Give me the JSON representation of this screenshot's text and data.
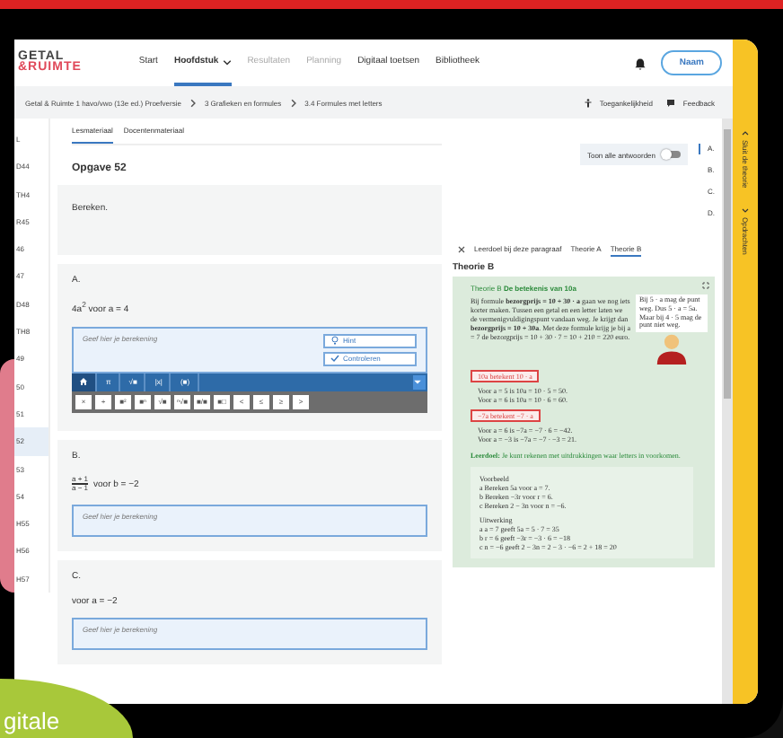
{
  "header": {
    "logo": {
      "line1": "GETAL",
      "line2": "&RUIMTE"
    },
    "nav": [
      {
        "label": "Start",
        "selected": false,
        "disabled": false,
        "dropdown": false
      },
      {
        "label": "Hoofdstuk",
        "selected": true,
        "disabled": false,
        "dropdown": true
      },
      {
        "label": "Resultaten",
        "selected": false,
        "disabled": true,
        "dropdown": false
      },
      {
        "label": "Planning",
        "selected": false,
        "disabled": true,
        "dropdown": false
      },
      {
        "label": "Digitaal toetsen",
        "selected": false,
        "disabled": false,
        "dropdown": false
      },
      {
        "label": "Bibliotheek",
        "selected": false,
        "disabled": false,
        "dropdown": false
      }
    ],
    "user_button": "Naam"
  },
  "breadcrumb": [
    "Getal & Ruimte 1 havo/vwo (13e ed.) Proefversie",
    "3 Grafieken en formules",
    "3.4 Formules met letters"
  ],
  "header_links": [
    {
      "kind": "accessibility",
      "label": "Toegankelijkheid"
    },
    {
      "kind": "feedback",
      "label": "Feedback"
    }
  ],
  "exercise_list": [
    {
      "label": "L",
      "selected": false
    },
    {
      "label": "D44",
      "selected": false
    },
    {
      "label": "TH4",
      "selected": false
    },
    {
      "label": "R45",
      "selected": false
    },
    {
      "label": "46",
      "selected": false
    },
    {
      "label": "47",
      "selected": false
    },
    {
      "label": "D48",
      "selected": false
    },
    {
      "label": "TH8",
      "selected": false
    },
    {
      "label": "49",
      "selected": false
    },
    {
      "label": "50",
      "selected": false
    },
    {
      "label": "51",
      "selected": false
    },
    {
      "label": "52",
      "selected": true
    },
    {
      "label": "53",
      "selected": false
    },
    {
      "label": "54",
      "selected": false
    },
    {
      "label": "H55",
      "selected": false
    },
    {
      "label": "H56",
      "selected": false
    },
    {
      "label": "H57",
      "selected": false
    }
  ],
  "content_tabs": [
    {
      "label": "Lesmateriaal",
      "selected": true
    },
    {
      "label": "Docentenmateriaal",
      "selected": false
    }
  ],
  "title": "Opgave 52",
  "intro": "Bereken.",
  "parts": [
    {
      "label": "A.",
      "formula": {
        "kind": "text",
        "text": "4a$^{2}$ voor a = 4"
      },
      "answer_placeholder": "Geef hier je berekening",
      "buttons": [
        {
          "kind": "hint",
          "label": "Hint"
        },
        {
          "kind": "check",
          "label": "Controleren"
        }
      ],
      "keyboard": {
        "tabs": [
          {
            "kind": "home",
            "selected": true
          },
          {
            "kind": "text",
            "label": "π",
            "selected": false
          },
          {
            "kind": "text",
            "label": "√■",
            "selected": false
          },
          {
            "kind": "text",
            "label": "|x|",
            "selected": false
          },
          {
            "kind": "text",
            "label": "(■)",
            "selected": false
          }
        ],
        "keys": [
          "×",
          "+",
          "■²",
          "■ⁿ",
          "√■",
          "ⁿ√■",
          "■/■",
          "■□",
          "<",
          "≤",
          "≥",
          ">"
        ]
      }
    },
    {
      "label": "B.",
      "formula": {
        "kind": "fraction",
        "numerator": "a + 1",
        "denominator": "a − 1",
        "text": "voor b = −2"
      },
      "answer_placeholder": "Geef hier je berekening"
    },
    {
      "label": "C.",
      "formula": {
        "kind": "text",
        "text": "voor a = −2"
      },
      "answer_placeholder": "Geef hier je berekening"
    }
  ],
  "answers_toggle": {
    "label": "Toon alle antwoorden",
    "on": false
  },
  "part_index": [
    {
      "label": "A.",
      "selected": true
    },
    {
      "label": "B.",
      "selected": false
    },
    {
      "label": "C.",
      "selected": false
    },
    {
      "label": "D.",
      "selected": false
    }
  ],
  "theory": {
    "tabs": [
      {
        "kind": "close",
        "selected": false
      },
      {
        "kind": "text",
        "label": "Leerdoel bij deze paragraaf",
        "selected": false
      },
      {
        "kind": "text",
        "label": "Theorie A",
        "selected": false
      },
      {
        "kind": "text",
        "label": "Theorie B",
        "selected": true
      }
    ],
    "heading": "Theorie B",
    "card_title": "Theorie B **De betekenis van 10a**",
    "body": "Bij formule **bezorgprijs = 10 + 30 · a** gaan we nog iets korter maken. Tussen een getal en een letter laten we de vermenigvuldigingspunt vandaan weg. Je krijgt dan **bezorgprijs = 10 + 30a**. Met deze formule krijg je bij a = 7 de bezorgprijs = 10 + 30 · 7 = 10 + 210 = 220 euro.",
    "bubble": "Bij 5 · a mag de punt weg. Dus 5 · a = 5a. Maar bij 4 · 5 mag de punt niet weg.",
    "rules": [
      {
        "tag": "10a betekent 10 · a",
        "lines": [
          "Voor a = 5 is 10a = 10 · 5 = 50.",
          "Voor a = 6 is 10a = 10 · 6 = 60."
        ]
      },
      {
        "tag": "−7a betekent −7 · a",
        "lines": [
          "Voor a = 6 is −7a = −7 · 6 = −42.",
          "Voor a = −3 is −7a = −7 · −3 = 21."
        ]
      }
    ],
    "goal": "**Leerdoel:** Je kunt rekenen met uitdrukkingen waar letters in voorkomen.",
    "example": {
      "title": "Voorbeeld",
      "lines": [
        "a  Bereken 5a voor a = 7.",
        "b  Bereken −3r voor r = 6.",
        "c  Bereken 2 − 3n voor n = −6."
      ],
      "solution_title": "Uitwerking",
      "solution": [
        "a  a = 7 geeft 5a = 5 · 7 = 35",
        "b  r = 6 geeft −3r = −3 · 6 = −18",
        "c  n = −6 geeft 2 − 3n = 2 − 3 · −6 = 2 + 18 = 20"
      ]
    }
  },
  "side_tabs": [
    {
      "kind": "up",
      "label": "Sluit de theorie"
    },
    {
      "kind": "down",
      "label": "Opdrachten"
    }
  ],
  "promo": {
    "text": "gitale"
  }
}
